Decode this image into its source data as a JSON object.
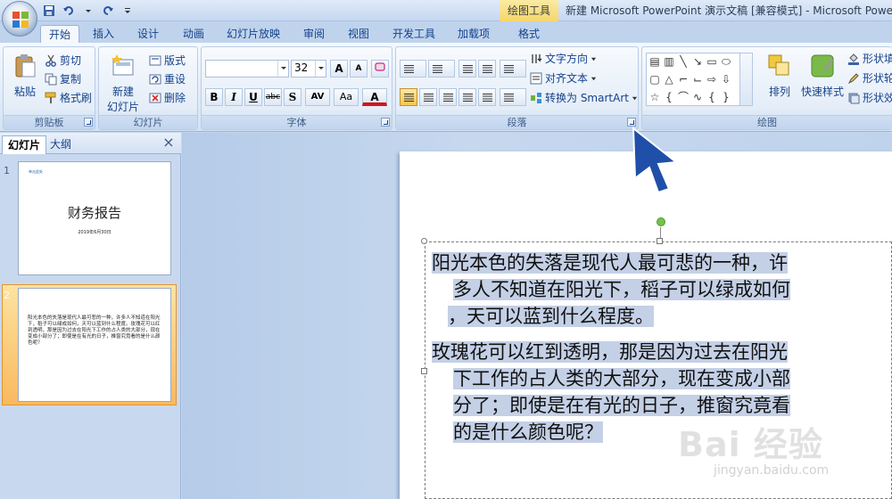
{
  "titlebar": {
    "context_tab": "绘图工具",
    "window_title": "新建 Microsoft PowerPoint 演示文稿 [兼容模式] - Microsoft PowerPoint"
  },
  "tabs": [
    {
      "label": "开始",
      "active": true
    },
    {
      "label": "插入"
    },
    {
      "label": "设计"
    },
    {
      "label": "动画"
    },
    {
      "label": "幻灯片放映"
    },
    {
      "label": "审阅"
    },
    {
      "label": "视图"
    },
    {
      "label": "开发工具"
    },
    {
      "label": "加载项"
    },
    {
      "label": "格式"
    }
  ],
  "ribbon": {
    "clipboard": {
      "paste": "粘贴",
      "cut": "剪切",
      "copy": "复制",
      "format_painter": "格式刷",
      "label": "剪贴板"
    },
    "slides": {
      "new_slide": "新建\n幻灯片",
      "new_slide_line1": "新建",
      "new_slide_line2": "幻灯片",
      "layout": "版式",
      "reset": "重设",
      "delete": "删除",
      "label": "幻灯片"
    },
    "font": {
      "font_name": "",
      "font_size": "32",
      "label": "字体",
      "bold": "B",
      "italic": "I",
      "underline": "U",
      "strike": "abc",
      "shadow": "S",
      "spacing": "AV",
      "case": "Aa",
      "color": "A",
      "grow": "A",
      "shrink": "A"
    },
    "paragraph": {
      "text_direction": "文字方向",
      "align_text": "对齐文本",
      "convert_smartart": "转换为 SmartArt",
      "label": "段落"
    },
    "drawing": {
      "arrange": "排列",
      "quick_styles": "快速样式",
      "shape_fill": "形状填",
      "shape_outline": "形状轮",
      "shape_effects": "形状效",
      "label": "绘图"
    }
  },
  "left_pane": {
    "tab_slides": "幻灯片",
    "tab_outline": "大纲",
    "slides": [
      {
        "number": "1",
        "small_text": "单击此处",
        "title": "财务报告",
        "date": "2019年6月30日"
      },
      {
        "number": "2",
        "text": "阳光本色的失落是现代人最可悲的一种，许多人不知道在阳光下，稻子可以绿成如何，天可以蓝到什么程度。玫瑰花可以红到透明，那是因为过去在阳光下工作的占人类的大部分，现在变成小部分了；即使是在有光的日子，推窗究竟看的是什么颜色呢？"
      }
    ]
  },
  "slide": {
    "para1_lines": [
      "阳光本色的失落是现代人最可悲的一种，许",
      "多人不知道在阳光下，稻子可以绿成如何",
      "，天可以蓝到什么程度。"
    ],
    "para2_lines": [
      "玫瑰花可以红到透明，那是因为过去在阳光",
      "下工作的占人类的大部分，现在变成小部",
      "分了；即使是在有光的日子，推窗究竟看",
      "的是什么颜色呢？"
    ]
  },
  "watermark": {
    "text": "Bai 经验",
    "url": "jingyan.baidu.com"
  },
  "colors": {
    "ribbon_text": "#15428b",
    "selection_highlight": "#c4d0e6",
    "context_tab": "#f6d66c",
    "cursor": "#1f4fa8"
  }
}
